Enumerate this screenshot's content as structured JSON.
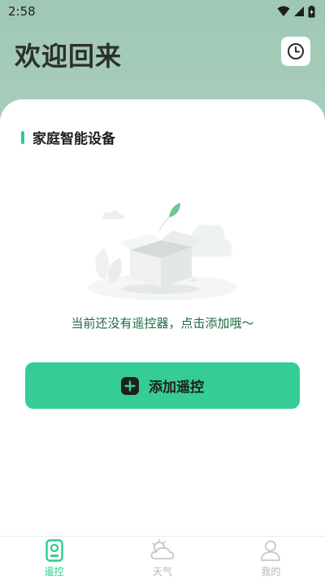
{
  "status_bar": {
    "time": "2:58"
  },
  "header": {
    "title": "欢迎回来",
    "history_icon": "clock-icon"
  },
  "section": {
    "title": "家庭智能设备"
  },
  "empty_state": {
    "message": "当前还没有遥控器，点击添加哦～",
    "illustration": "empty-box-illustration"
  },
  "add_button": {
    "label": "添加遥控",
    "icon": "plus-icon"
  },
  "bottom_nav": {
    "items": [
      {
        "label": "遥控",
        "icon": "remote-icon",
        "active": true
      },
      {
        "label": "天气",
        "icon": "weather-icon",
        "active": false
      },
      {
        "label": "我的",
        "icon": "profile-icon",
        "active": false
      }
    ]
  },
  "colors": {
    "accent": "#35cd95",
    "accent_dark": "#2fcb8e",
    "header_bg": "#a6ccba",
    "empty_text": "#1e6a43",
    "nav_inactive": "#b3b6b5"
  }
}
